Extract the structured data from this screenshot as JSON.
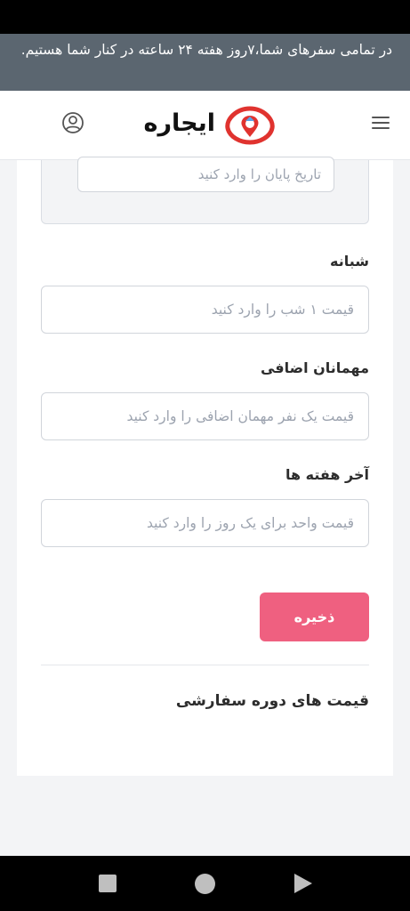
{
  "banner": {
    "text": "در تمامی سفرهای شما،۷روز هفته ۲۴ ساعته در کنار شما هستیم."
  },
  "header": {
    "brand_name": "ایجاره"
  },
  "form": {
    "end_date_placeholder": "تاریخ پایان را وارد کنید",
    "nightly": {
      "label": "شبانه",
      "placeholder": "قیمت ۱ شب را وارد کنید"
    },
    "extra_guests": {
      "label": "مهمانان اضافی",
      "placeholder": "قیمت یک نفر مهمان اضافی را وارد کنید"
    },
    "weekends": {
      "label": "آخر هفته ها",
      "placeholder": "قیمت واحد برای یک روز را وارد کنید"
    },
    "save_label": "ذخیره"
  },
  "custom_pricing": {
    "title": "قیمت های دوره سفارشی"
  },
  "colors": {
    "accent": "#ef6080",
    "banner_bg": "#5b6670",
    "logo_red": "#e0332f"
  },
  "icons": {
    "menu": "hamburger-menu-icon",
    "user": "user-circle-icon",
    "logo": "brand-logo-icon"
  }
}
